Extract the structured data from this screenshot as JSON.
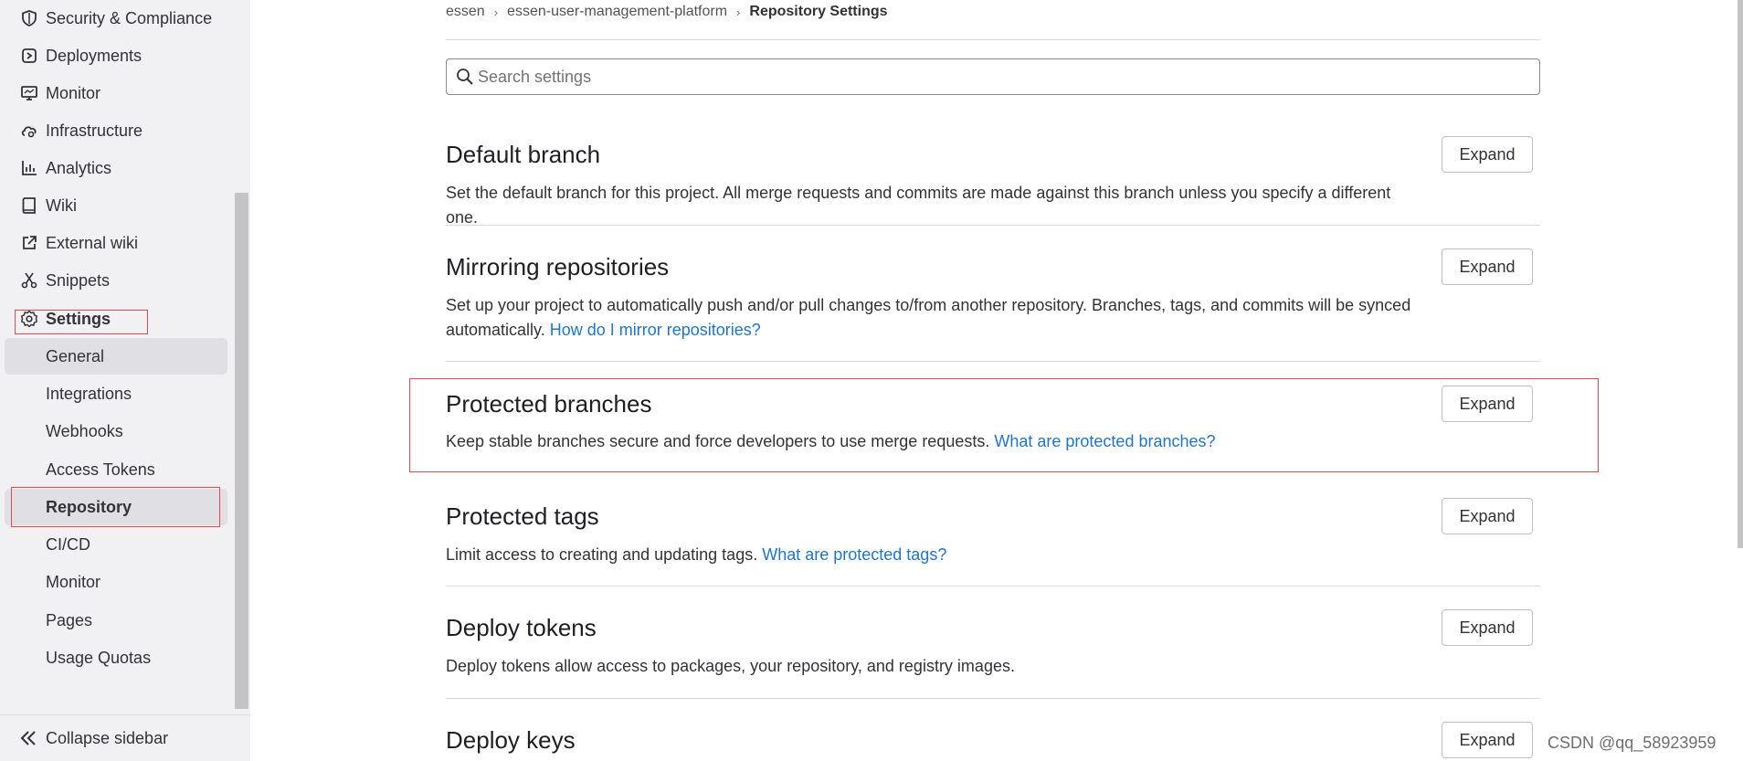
{
  "sidebar": {
    "items": [
      {
        "label": "Security & Compliance",
        "icon": "shield-icon"
      },
      {
        "label": "Deployments",
        "icon": "rocket-icon"
      },
      {
        "label": "Monitor",
        "icon": "monitor-icon"
      },
      {
        "label": "Infrastructure",
        "icon": "cloud-gear-icon"
      },
      {
        "label": "Analytics",
        "icon": "chart-icon"
      },
      {
        "label": "Wiki",
        "icon": "book-icon"
      },
      {
        "label": "External wiki",
        "icon": "external-link-icon"
      },
      {
        "label": "Snippets",
        "icon": "scissors-icon"
      },
      {
        "label": "Settings",
        "icon": "gear-icon"
      }
    ],
    "settings_subitems": [
      {
        "label": "General"
      },
      {
        "label": "Integrations"
      },
      {
        "label": "Webhooks"
      },
      {
        "label": "Access Tokens"
      },
      {
        "label": "Repository"
      },
      {
        "label": "CI/CD"
      },
      {
        "label": "Monitor"
      },
      {
        "label": "Pages"
      },
      {
        "label": "Usage Quotas"
      }
    ],
    "collapse_label": "Collapse sidebar"
  },
  "breadcrumb": [
    "essen",
    "essen-user-management-platform",
    "Repository Settings"
  ],
  "search": {
    "placeholder": "Search settings",
    "value": ""
  },
  "sections": [
    {
      "title": "Default branch",
      "description": "Set the default branch for this project. All merge requests and commits are made against this branch unless you specify a different one.",
      "link": "",
      "button": "Expand"
    },
    {
      "title": "Mirroring repositories",
      "description": "Set up your project to automatically push and/or pull changes to/from another repository. Branches, tags, and commits will be synced automatically.",
      "link": "How do I mirror repositories?",
      "button": "Expand"
    },
    {
      "title": "Protected branches",
      "description": "Keep stable branches secure and force developers to use merge requests.",
      "link": "What are protected branches?",
      "button": "Expand"
    },
    {
      "title": "Protected tags",
      "description": "Limit access to creating and updating tags.",
      "link": "What are protected tags?",
      "button": "Expand"
    },
    {
      "title": "Deploy tokens",
      "description": "Deploy tokens allow access to packages, your repository, and registry images.",
      "link": "",
      "button": "Expand"
    },
    {
      "title": "Deploy keys",
      "description": "",
      "link": "",
      "button": "Expand"
    }
  ],
  "watermark": "CSDN @qq_58923959",
  "colors": {
    "link": "#1f75cb",
    "highlight_border": "#e5484d",
    "active_bg": "#e0dfe3"
  }
}
